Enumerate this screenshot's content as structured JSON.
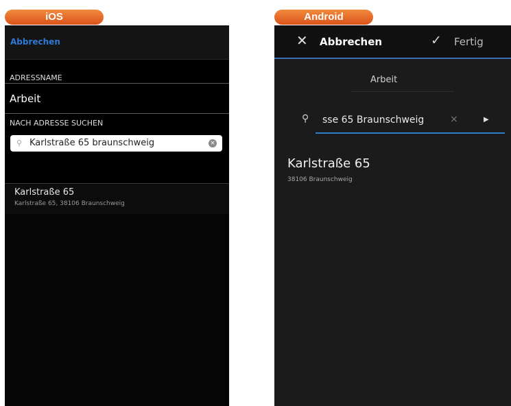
{
  "labels": {
    "ios": "iOS",
    "android": "Android"
  },
  "ios": {
    "nav": {
      "cancel": "Abbrechen"
    },
    "address_name_header": "ADRESSNAME",
    "address_name_value": "Arbeit",
    "search_header": "NACH ADRESSE SUCHEN",
    "search_value": "Karlstraße 65 braunschweig",
    "result": {
      "title": "Karlstraße 65",
      "subtitle": "Karlstraße 65, 38106 Braunschweig"
    }
  },
  "android": {
    "actionbar": {
      "cancel": "Abbrechen",
      "done": "Fertig"
    },
    "address_name_value": "Arbeit",
    "search_value": "sse 65 Braunschweig",
    "result": {
      "title": "Karlstraße 65",
      "subtitle": "38106 Braunschweig"
    }
  },
  "icons": [
    "close-icon",
    "check-icon",
    "search-icon",
    "clear-icon",
    "go-arrow-icon"
  ]
}
